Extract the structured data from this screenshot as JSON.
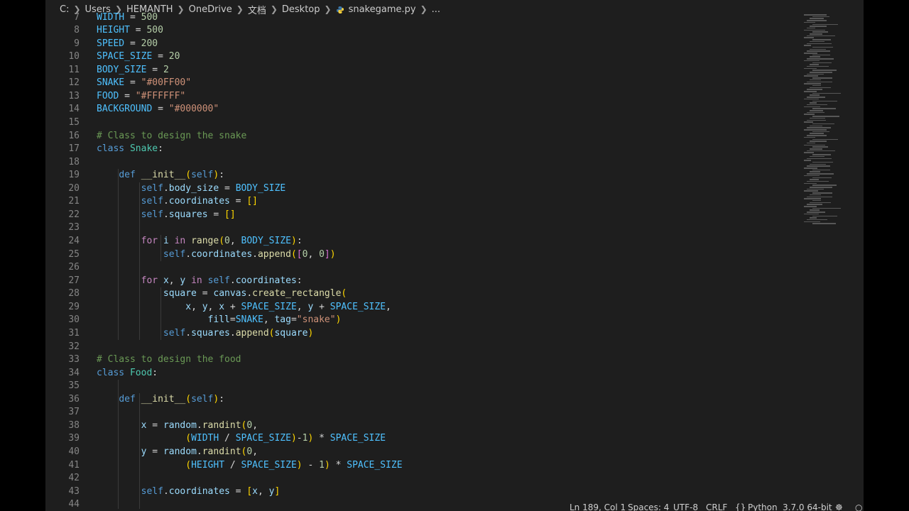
{
  "breadcrumb": {
    "parts": [
      "C:",
      "Users",
      "HEMANTH",
      "OneDrive",
      "文档",
      "Desktop",
      "snakegame.py",
      "..."
    ]
  },
  "editor": {
    "lines": [
      {
        "n": "7",
        "text": "WIDTH = 500"
      },
      {
        "n": "8",
        "text": "HEIGHT = 500"
      },
      {
        "n": "9",
        "text": "SPEED = 200"
      },
      {
        "n": "10",
        "text": "SPACE_SIZE = 20"
      },
      {
        "n": "11",
        "text": "BODY_SIZE = 2"
      },
      {
        "n": "12",
        "text": "SNAKE = \"#00FF00\""
      },
      {
        "n": "13",
        "text": "FOOD = \"#FFFFFF\""
      },
      {
        "n": "14",
        "text": "BACKGROUND = \"#000000\""
      },
      {
        "n": "15",
        "text": ""
      },
      {
        "n": "16",
        "text": "# Class to design the snake"
      },
      {
        "n": "17",
        "text": "class Snake:"
      },
      {
        "n": "18",
        "text": ""
      },
      {
        "n": "19",
        "text": "    def __init__(self):"
      },
      {
        "n": "20",
        "text": "        self.body_size = BODY_SIZE"
      },
      {
        "n": "21",
        "text": "        self.coordinates = []"
      },
      {
        "n": "22",
        "text": "        self.squares = []"
      },
      {
        "n": "23",
        "text": ""
      },
      {
        "n": "24",
        "text": "        for i in range(0, BODY_SIZE):"
      },
      {
        "n": "25",
        "text": "            self.coordinates.append([0, 0])"
      },
      {
        "n": "26",
        "text": ""
      },
      {
        "n": "27",
        "text": "        for x, y in self.coordinates:"
      },
      {
        "n": "28",
        "text": "            square = canvas.create_rectangle("
      },
      {
        "n": "29",
        "text": "                x, y, x + SPACE_SIZE, y + SPACE_SIZE,"
      },
      {
        "n": "30",
        "text": "                    fill=SNAKE, tag=\"snake\")"
      },
      {
        "n": "31",
        "text": "            self.squares.append(square)"
      },
      {
        "n": "32",
        "text": ""
      },
      {
        "n": "33",
        "text": "# Class to design the food"
      },
      {
        "n": "34",
        "text": "class Food:"
      },
      {
        "n": "35",
        "text": ""
      },
      {
        "n": "36",
        "text": "    def __init__(self):"
      },
      {
        "n": "37",
        "text": ""
      },
      {
        "n": "38",
        "text": "        x = random.randint(0,"
      },
      {
        "n": "39",
        "text": "                (WIDTH / SPACE_SIZE)-1) * SPACE_SIZE"
      },
      {
        "n": "40",
        "text": "        y = random.randint(0,"
      },
      {
        "n": "41",
        "text": "                (HEIGHT / SPACE_SIZE) - 1) * SPACE_SIZE"
      },
      {
        "n": "42",
        "text": ""
      },
      {
        "n": "43",
        "text": "        self.coordinates = [x, y]"
      },
      {
        "n": "44",
        "text": ""
      }
    ]
  },
  "statusbar": {
    "position": "Ln 189, Col 1",
    "spaces": "Spaces: 4",
    "encoding": "UTF-8",
    "eol": "CRLF",
    "language": "Python",
    "interpreter": "3.7.0 64-bit"
  },
  "colors": {
    "editor_bg": "#1e1e1e",
    "outer_bg": "#000000",
    "line_number": "#858585",
    "comment": "#6a9955",
    "string": "#ce9178",
    "keyword": "#c586c0"
  }
}
